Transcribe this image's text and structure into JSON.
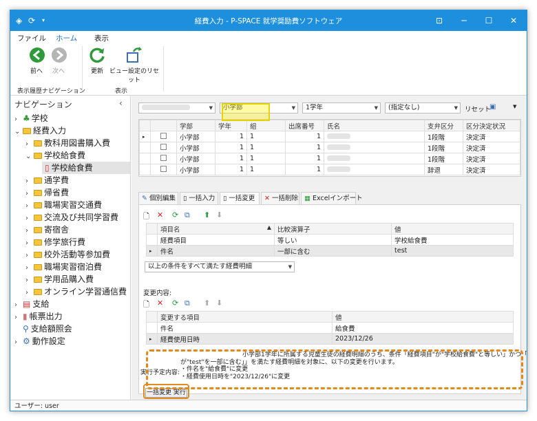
{
  "window": {
    "title": "経費入力 - P-SPACE 就学奨励費ソフトウェア"
  },
  "ribbon": {
    "tabs": [
      "ファイル",
      "ホーム",
      "表示"
    ],
    "buttons": {
      "back": "前へ",
      "forward": "次へ",
      "refresh": "更新",
      "view_reset": "ビュー設定のリセット"
    },
    "groups": {
      "history": "表示履歴ナビゲーション",
      "view": "表示"
    }
  },
  "nav": {
    "header": "ナビゲーション",
    "items": [
      "学校",
      "経費入力",
      "教科用図書購入費",
      "学校給食費",
      "学校給食費",
      "通学費",
      "帰省費",
      "職場実習交通費",
      "交流及び共同学習費",
      "寄宿舎",
      "修学旅行費",
      "校外活動等参加費",
      "職場実習宿泊費",
      "学用品購入費",
      "オンライン学習通信費",
      "支給",
      "帳票出力",
      "支給額照会",
      "動作設定"
    ]
  },
  "filter": {
    "school_level": "小学部",
    "grade": "1学年",
    "unspecified": "(指定なし)",
    "reset": "リセット"
  },
  "students": {
    "columns": [
      "学部",
      "学年",
      "組",
      "出席番号",
      "氏名",
      "支弁区分",
      "区分決定状況"
    ],
    "rows": [
      [
        "小学部",
        "1",
        "1",
        "1",
        "",
        "1段階",
        "決定済"
      ],
      [
        "小学部",
        "1",
        "1",
        "1",
        "",
        "1段階",
        "決定済"
      ],
      [
        "小学部",
        "1",
        "1",
        "1",
        "",
        "1段階",
        "決定済"
      ],
      [
        "小学部",
        "1",
        "1",
        "1",
        "",
        "辞退",
        "決定済"
      ]
    ]
  },
  "tabs": [
    "個別編集",
    "一括入力",
    "一括変更",
    "一括削除",
    "Excelインポート"
  ],
  "conditions": {
    "columns": [
      "項目名",
      "比較演算子",
      "値"
    ],
    "rows": [
      [
        "経費項目",
        "等しい",
        "学校給食費"
      ],
      [
        "件名",
        "一部に含む",
        "test"
      ]
    ],
    "match_mode": "以上の条件をすべて満たす経費明細"
  },
  "changes": {
    "label": "変更内容:",
    "columns": [
      "変更する項目",
      "値"
    ],
    "rows": [
      [
        "件名",
        "給食費"
      ],
      [
        "経費使用日時",
        "2023/12/26"
      ]
    ]
  },
  "plan": {
    "label": "実行予定内容:",
    "line1": "小学部1学年に所属する児童生徒の経費明細のうち、条件「経費項目\"が\"学校給食費\"と等しい」かつ「件名",
    "line2": "が\"test\"を一部に含む」」を満たす経費明細を対象に、以下の変更を行います。",
    "line3": "・件名を\"給食費\"に変更",
    "line4": "・経費使用日時を\"2023/12/26\"に変更"
  },
  "execute_label": "一括変更 実行",
  "status": "ユーザー: user"
}
